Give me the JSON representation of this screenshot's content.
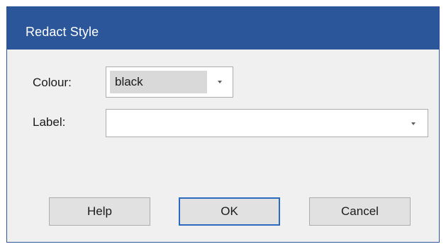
{
  "dialog": {
    "title": "Redact Style"
  },
  "fields": {
    "colour": {
      "label": "Colour:",
      "value": "black"
    },
    "label": {
      "label": "Label:",
      "value": ""
    }
  },
  "buttons": {
    "help": "Help",
    "ok": "OK",
    "cancel": "Cancel"
  },
  "icons": {
    "dropdown": "chevron-down-icon"
  },
  "colors": {
    "title_bar": "#2b579a",
    "dialog_background": "#f0f0f0",
    "default_button_border": "#2c6ac0"
  }
}
